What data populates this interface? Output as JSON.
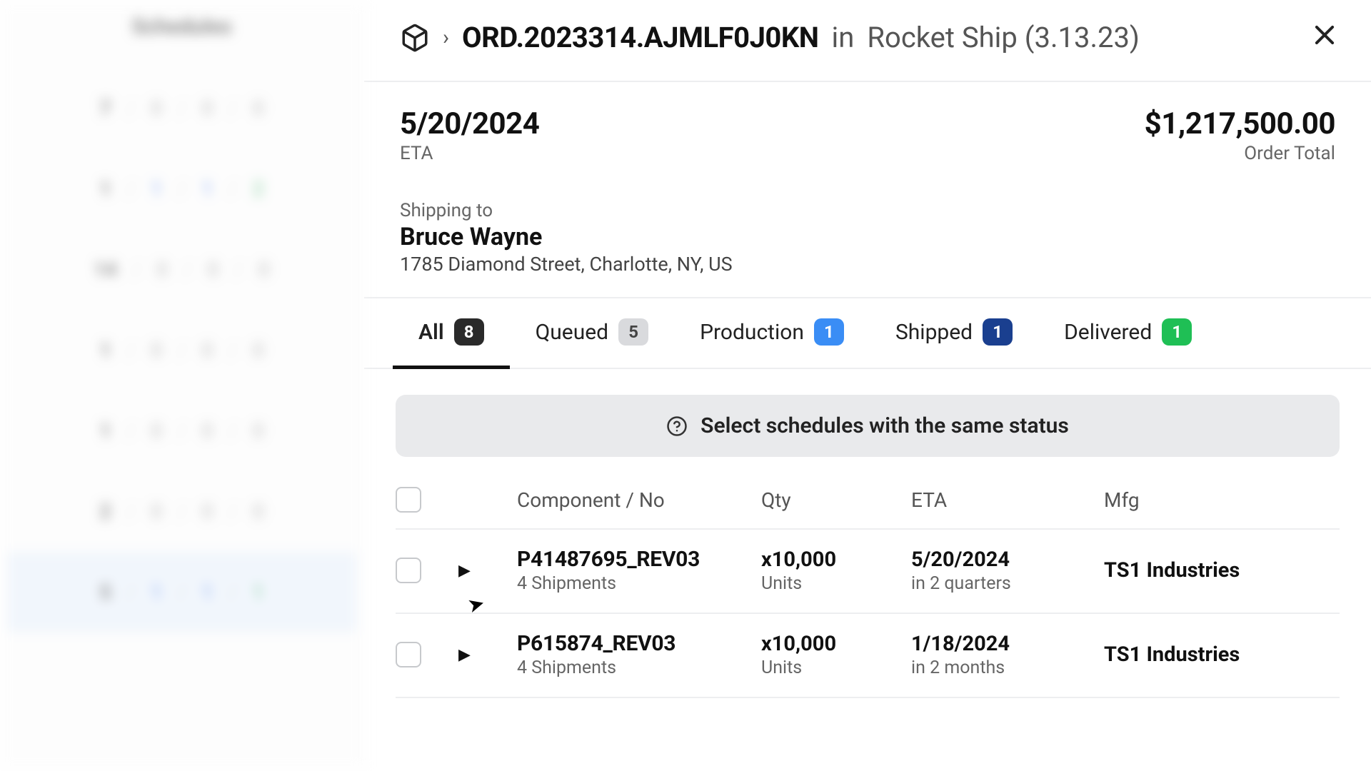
{
  "sidebar": {
    "title": "Schedules",
    "rows": [
      [
        "7",
        "0",
        "0",
        "0"
      ],
      [
        "1",
        "1",
        "1",
        "2"
      ],
      [
        "14",
        "0",
        "0",
        "0"
      ],
      [
        "1",
        "0",
        "0",
        "0"
      ],
      [
        "1",
        "0",
        "0",
        "0"
      ],
      [
        "2",
        "0",
        "0",
        "0"
      ],
      [
        "5",
        "1",
        "1",
        "1"
      ]
    ]
  },
  "breadcrumb": {
    "order_id": "ORD.2023314.AJMLF0J0KN",
    "in_label": "in",
    "project": "Rocket Ship (3.13.23)"
  },
  "summary": {
    "eta_value": "5/20/2024",
    "eta_label": "ETA",
    "total_value": "$1,217,500.00",
    "total_label": "Order Total"
  },
  "shipping": {
    "label": "Shipping to",
    "name": "Bruce Wayne",
    "address": "1785 Diamond Street, Charlotte, NY, US"
  },
  "tabs": [
    {
      "label": "All",
      "count": "8",
      "variant": "dark",
      "active": true
    },
    {
      "label": "Queued",
      "count": "5",
      "variant": "gray",
      "active": false
    },
    {
      "label": "Production",
      "count": "1",
      "variant": "blue",
      "active": false
    },
    {
      "label": "Shipped",
      "count": "1",
      "variant": "navy",
      "active": false
    },
    {
      "label": "Delivered",
      "count": "1",
      "variant": "green",
      "active": false
    }
  ],
  "banner": {
    "text": "Select schedules with the same status"
  },
  "table": {
    "headers": {
      "component": "Component / No",
      "qty": "Qty",
      "eta": "ETA",
      "mfg": "Mfg"
    },
    "rows": [
      {
        "component": "P41487695_REV03",
        "shipments": "4 Shipments",
        "qty": "x10,000",
        "qty_unit": "Units",
        "eta": "5/20/2024",
        "eta_rel": "in 2 quarters",
        "mfg": "TS1 Industries"
      },
      {
        "component": "P615874_REV03",
        "shipments": "4 Shipments",
        "qty": "x10,000",
        "qty_unit": "Units",
        "eta": "1/18/2024",
        "eta_rel": "in 2 months",
        "mfg": "TS1 Industries"
      }
    ]
  }
}
